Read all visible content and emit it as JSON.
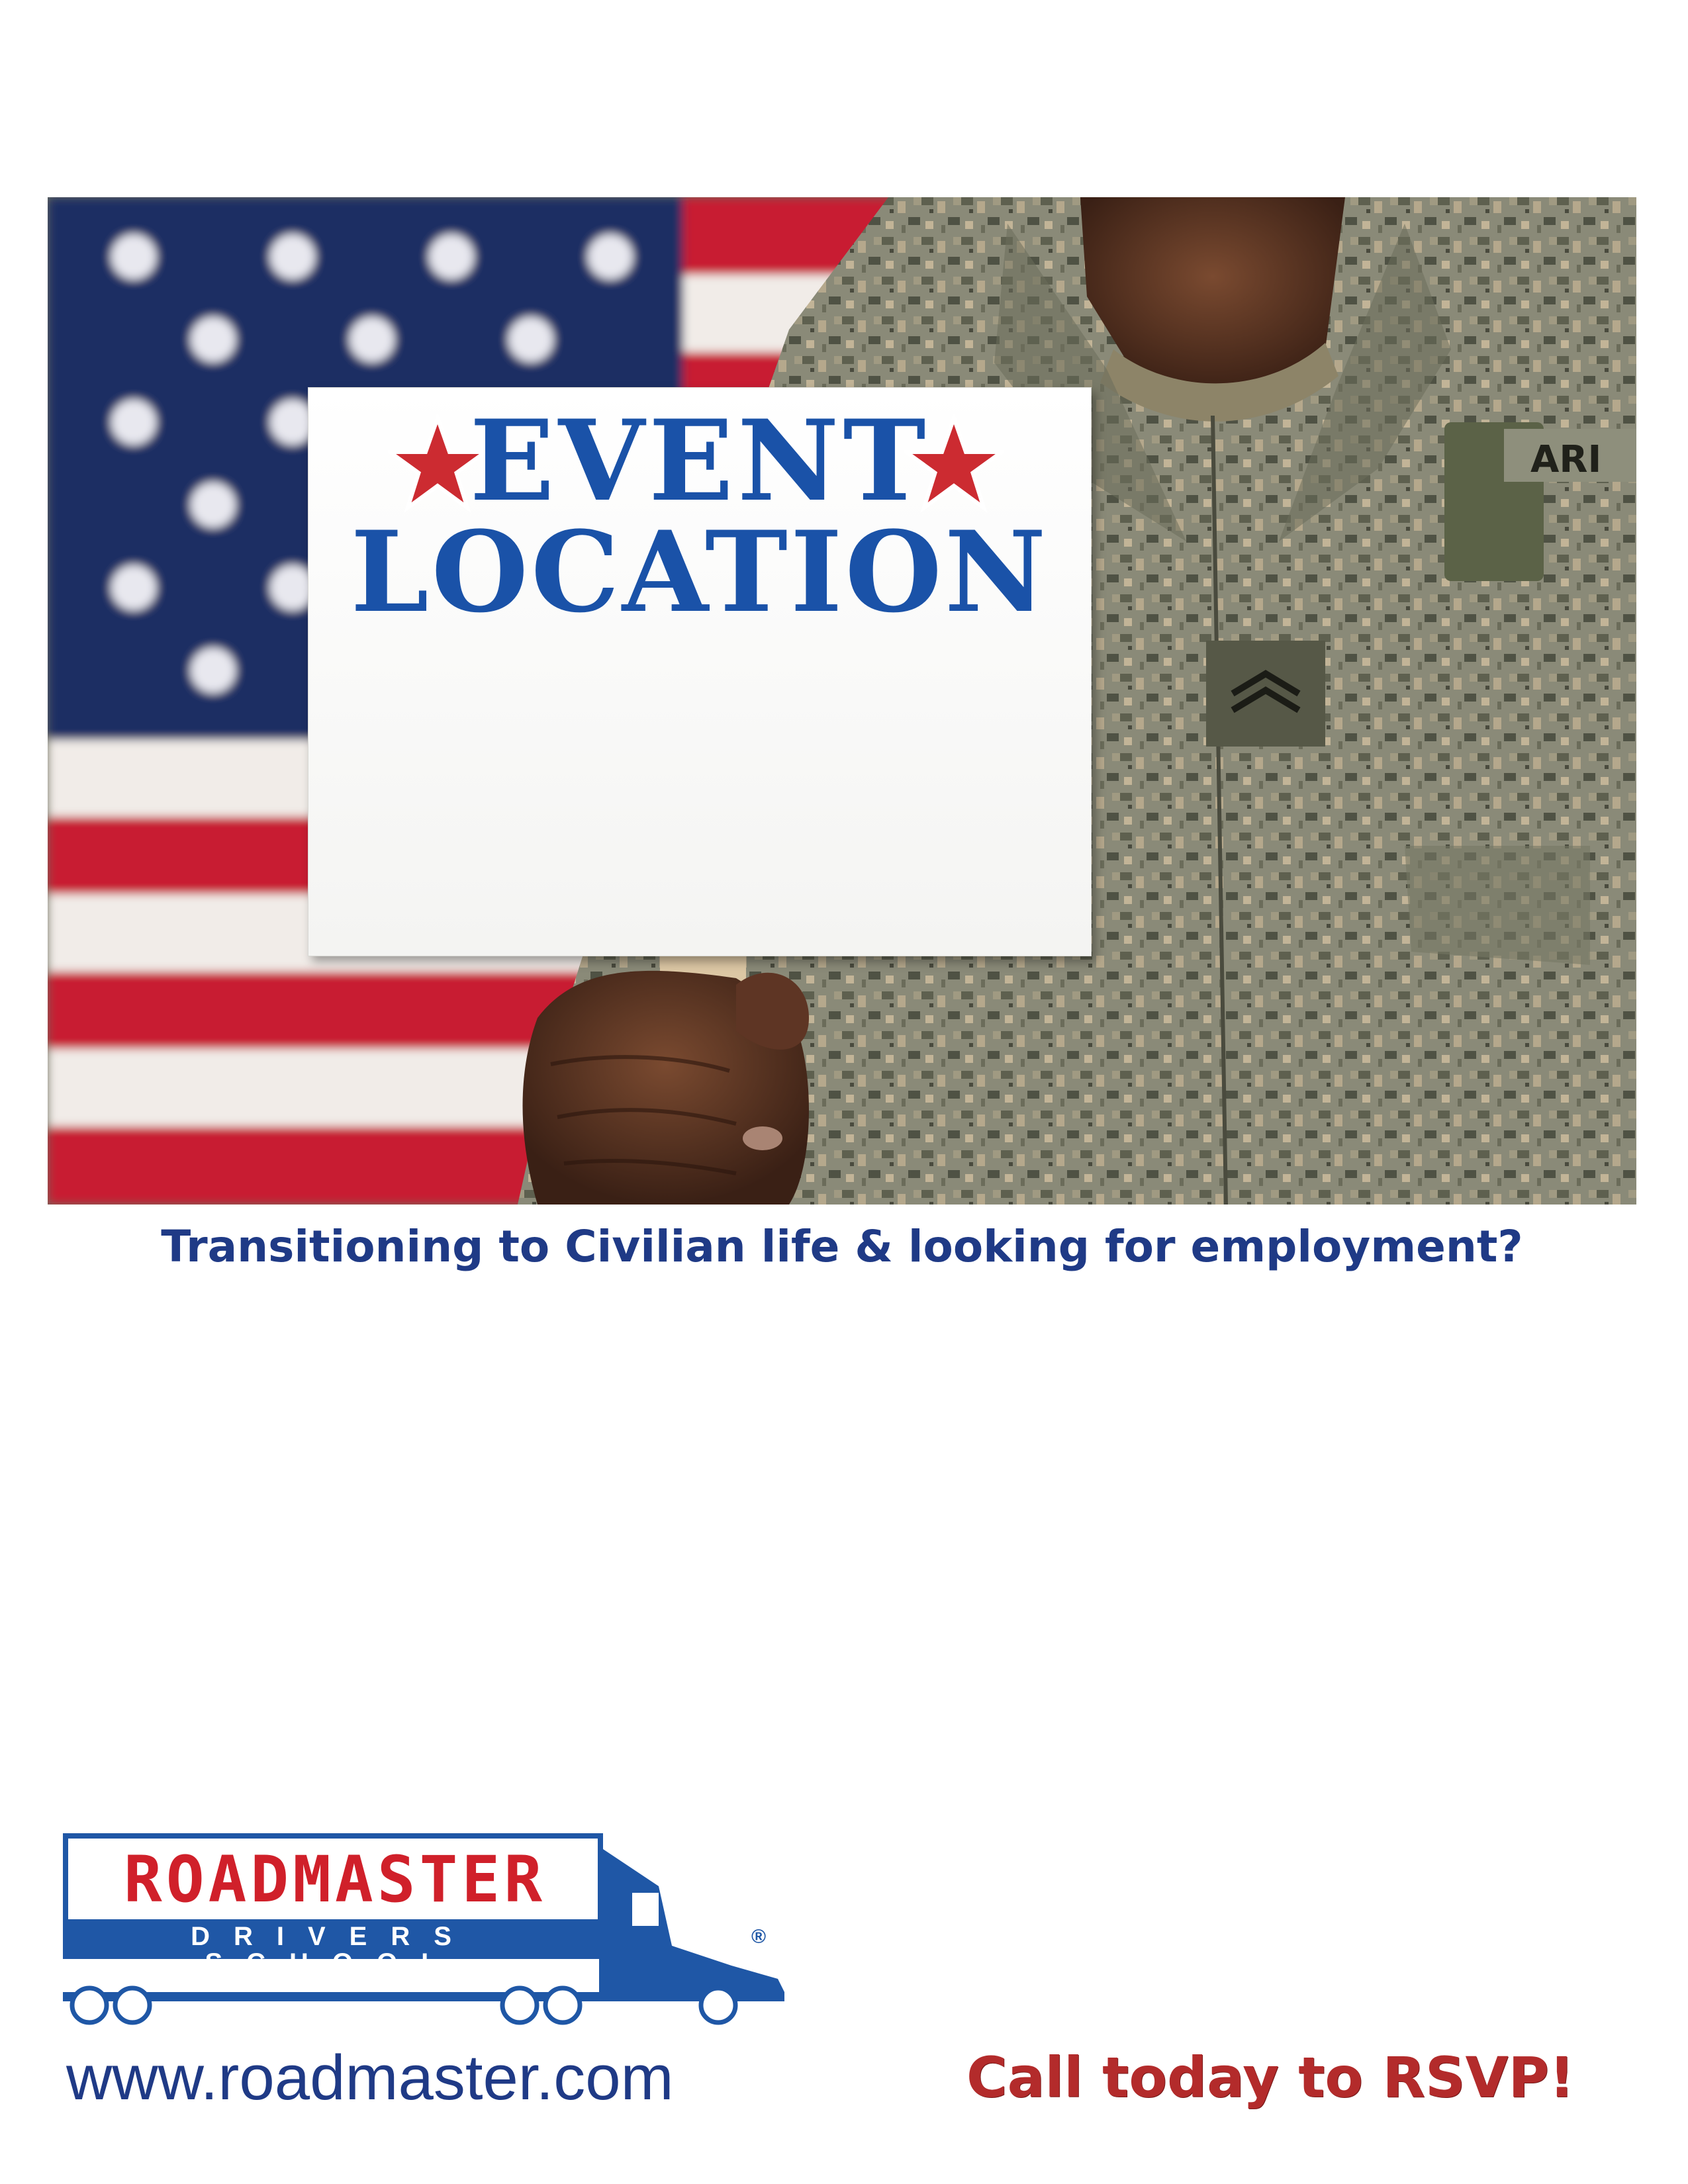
{
  "hero": {
    "sign": {
      "line1": "EVENT",
      "line2": "LOCATION"
    },
    "patch_text": "ARI"
  },
  "tagline": "Transitioning to Civilian life & looking for employment?",
  "logo": {
    "brand": "ROADMASTER",
    "subtitle": "DRIVERS SCHOOL",
    "registered": "®"
  },
  "footer": {
    "website": "www.roadmaster.com",
    "call_to_action": "Call today to RSVP!"
  },
  "colors": {
    "brand_blue": "#1f57a6",
    "brand_red": "#d0202a",
    "headline_blue": "#1f3a86",
    "cta_red": "#b32b2b"
  }
}
